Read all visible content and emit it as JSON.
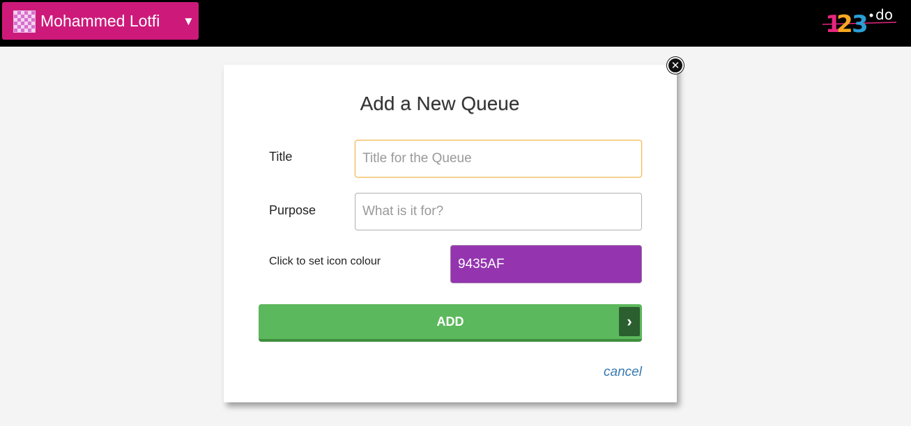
{
  "header": {
    "user_name": "Mohammed Lotfi",
    "caret": "▼",
    "user_menu_color": "#cd1a7a",
    "logo": {
      "text_digits": [
        "1",
        "2",
        "3"
      ],
      "text_suffix": "do",
      "colors": [
        "#e7267e",
        "#f6a821",
        "#2a9fd6"
      ]
    }
  },
  "modal": {
    "title": "Add a New Queue",
    "close_glyph": "✕",
    "fields": {
      "title": {
        "label": "Title",
        "placeholder": "Title for the Queue",
        "value": ""
      },
      "purpose": {
        "label": "Purpose",
        "placeholder": "What is it for?",
        "value": ""
      },
      "icon_colour": {
        "label": "Click to set icon colour",
        "value": "9435AF",
        "color": "#9435AF"
      }
    },
    "add_button": {
      "label": "ADD",
      "arrow": "›"
    },
    "cancel_link": "cancel"
  }
}
